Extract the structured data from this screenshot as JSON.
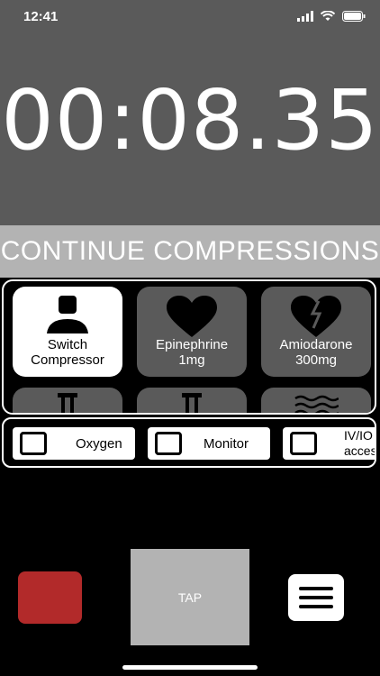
{
  "status": {
    "time": "12:41"
  },
  "timer": {
    "value": "00:08.35"
  },
  "banner": {
    "text": "CONTINUE COMPRESSIONS"
  },
  "drugs": [
    {
      "label1": "Switch",
      "label2": "Compressor",
      "icon": "person-icon"
    },
    {
      "label1": "Epinephrine",
      "label2": "1mg",
      "icon": "heart-icon"
    },
    {
      "label1": "Amiodarone",
      "label2": "300mg",
      "icon": "broken-heart-icon"
    }
  ],
  "checklist": [
    {
      "label": "Oxygen"
    },
    {
      "label": "Monitor"
    },
    {
      "label": "IV/IO access"
    }
  ],
  "controls": {
    "tap_label": "TAP"
  },
  "colors": {
    "top_bg": "#5a5a5a",
    "banner_bg": "#b3b3b3",
    "stop": "#b22a2a"
  }
}
